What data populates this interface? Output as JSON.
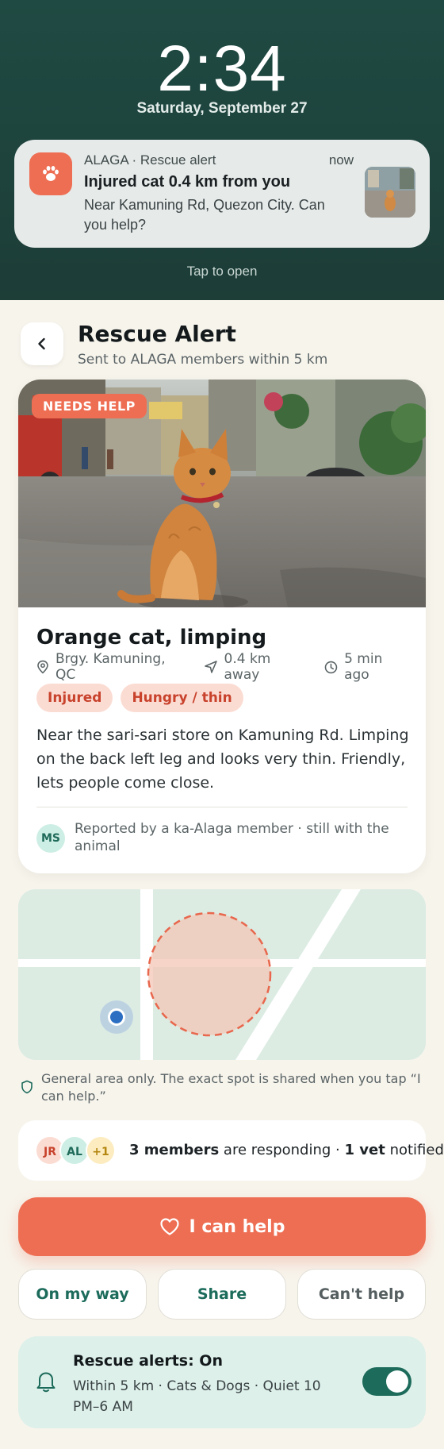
{
  "lock": {
    "time": "2:34",
    "date": "Saturday, September 27",
    "notification": {
      "app": "ALAGA · Rescue alert",
      "when": "now",
      "title": "Injured cat 0.4 km from you",
      "body": "Near Kamuning Rd, Quezon City. Can you help?"
    },
    "tap_hint": "Tap to open"
  },
  "header": {
    "title": "Rescue Alert",
    "subtitle": "Sent to ALAGA members within 5 km"
  },
  "alert": {
    "badge": "NEEDS HELP",
    "title": "Orange cat, limping",
    "location": "Brgy. Kamuning, QC",
    "distance": "0.4 km away",
    "time_ago": "5 min ago",
    "tags": [
      "Injured",
      "Hungry / thin"
    ],
    "description": "Near the sari-sari store on Kamuning Rd. Limping on the back left leg and looks very thin. Friendly, lets people come close.",
    "reporter_initials": "MS",
    "reporter_text": "Reported by a ka-Alaga member · still with the animal"
  },
  "map": {
    "privacy_note": "General area only. The exact spot is shared when you tap “I can help.”"
  },
  "responders": {
    "avatars": [
      "JR",
      "AL",
      "+1"
    ],
    "members_count": "3 members",
    "members_suffix": " are responding · ",
    "vet_count": "1 vet",
    "vet_suffix": " notified"
  },
  "actions": {
    "primary": "I can help",
    "on_my_way": "On my way",
    "share": "Share",
    "cant_help": "Can't help"
  },
  "settings": {
    "title": "Rescue alerts: On",
    "description": "Within 5 km · Cats & Dogs · Quiet 10 PM–6 AM",
    "enabled": true
  },
  "colors": {
    "accent": "#ee6e53",
    "primary_green": "#1d6b5b",
    "lock_bg": "#1f4a43",
    "page_bg": "#f7f4ec"
  }
}
